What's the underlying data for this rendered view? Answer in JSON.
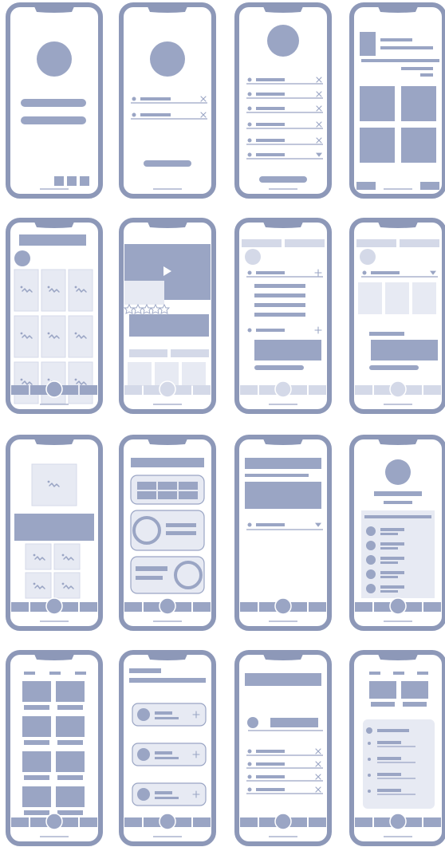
{
  "palette": {
    "frame": "#8d98b8",
    "block": "#9aa5c4",
    "light": "#d4d9e8",
    "fill_light": "#e7eaf3",
    "background": "#ffffff",
    "line": "#9aa5c4"
  },
  "screens": [
    {
      "id": "splash-login",
      "icon": "avatar-circle"
    },
    {
      "id": "login-form",
      "icon": "avatar-circle"
    },
    {
      "id": "settings-list",
      "icon": "avatar-circle"
    },
    {
      "id": "gallery-grid",
      "icon": "image-grid"
    },
    {
      "id": "photo-grid",
      "icon": "image-grid"
    },
    {
      "id": "video-player",
      "icon": "play-icon"
    },
    {
      "id": "dropdown-overlay",
      "icon": "plus-icon"
    },
    {
      "id": "filter-overlay",
      "icon": "chevron-icon"
    },
    {
      "id": "product-detail",
      "icon": "image-icon"
    },
    {
      "id": "dashboard-cards",
      "icon": "donut-chart"
    },
    {
      "id": "form-select",
      "icon": "chevron-icon"
    },
    {
      "id": "profile-list",
      "icon": "avatar-circle"
    },
    {
      "id": "product-catalog",
      "icon": "grid"
    },
    {
      "id": "contacts-list",
      "icon": "plus-icon"
    },
    {
      "id": "account-settings",
      "icon": "close-icon"
    },
    {
      "id": "menu-list",
      "icon": "bullet-list"
    }
  ]
}
